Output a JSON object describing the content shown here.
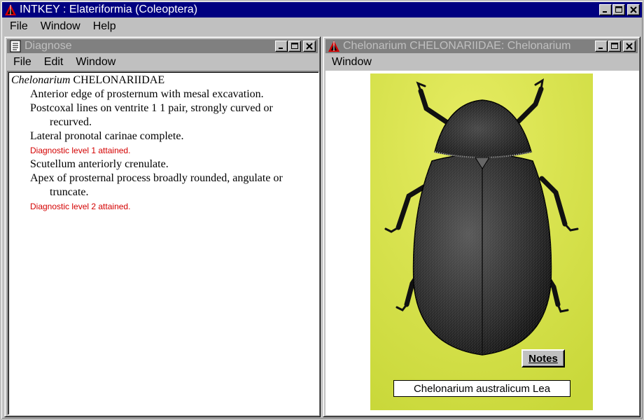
{
  "app": {
    "title": "INTKEY : Elateriformia (Coleoptera)",
    "menu": [
      "File",
      "Window",
      "Help"
    ],
    "icon": "intkey-logo-icon"
  },
  "diagnose": {
    "title": "Diagnose",
    "menu": [
      "File",
      "Edit",
      "Window"
    ],
    "icon": "document-icon",
    "taxon_genus": "Chelonarium",
    "taxon_family": "CHELONARIIDAE",
    "lines": [
      {
        "type": "char",
        "text": "Anterior edge of prosternum with mesal excavation."
      },
      {
        "type": "char",
        "text": "Postcoxal lines on ventrite 1 1 pair, strongly curved or",
        "cont": "recurved."
      },
      {
        "type": "char",
        "text": "Lateral pronotal carinae complete."
      },
      {
        "type": "level",
        "text": "Diagnostic level 1 attained."
      },
      {
        "type": "char",
        "text": "Scutellum anteriorly crenulate."
      },
      {
        "type": "char",
        "text": "Apex of prosternal process broadly rounded, angulate or",
        "cont": "truncate."
      },
      {
        "type": "level",
        "text": "Diagnostic level 2 attained."
      }
    ]
  },
  "image_window": {
    "title": "Chelonarium CHELONARIIDAE: Chelonarium",
    "menu": [
      "Window"
    ],
    "icon": "intkey-logo-icon",
    "notes_label": "Notes",
    "caption": "Chelonarium australicum Lea",
    "background_color": "#d6e04a"
  },
  "colors": {
    "active_title": "#000080",
    "inactive_title": "#808080",
    "level_text": "#d40000"
  }
}
